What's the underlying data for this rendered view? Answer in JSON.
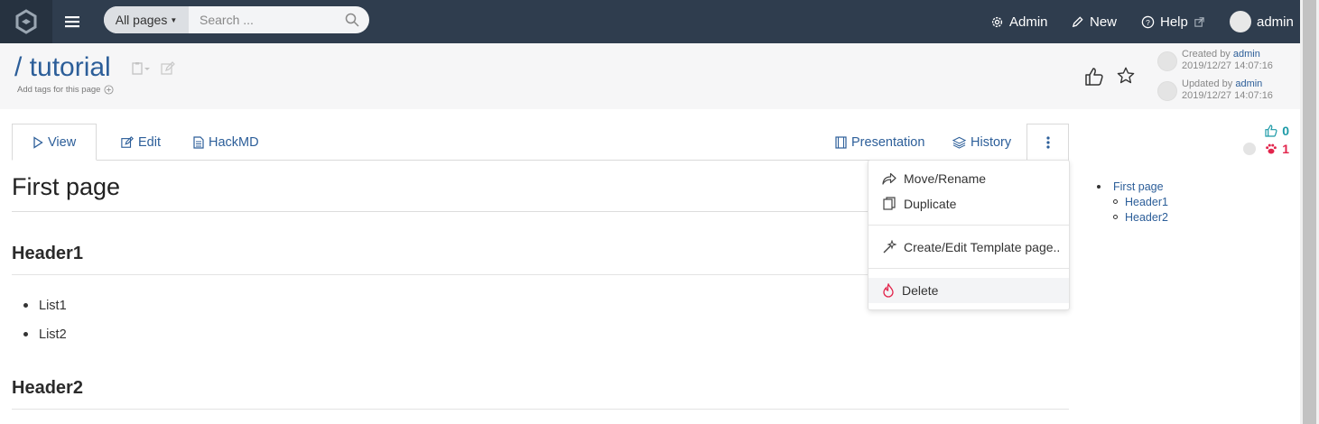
{
  "navbar": {
    "search_scope": "All pages",
    "search_placeholder": "Search ...",
    "admin_label": "Admin",
    "new_label": "New",
    "help_label": "Help",
    "user_label": "admin"
  },
  "page": {
    "path": "/ tutorial",
    "add_tags_text": "Add tags for this page",
    "created_prefix": "Created by",
    "created_user": "admin",
    "created_at": "2019/12/27 14:07:16",
    "updated_prefix": "Updated by",
    "updated_user": "admin",
    "updated_at": "2019/12/27 14:07:16"
  },
  "tabs": {
    "view": "View",
    "edit": "Edit",
    "hackmd": "HackMD",
    "presentation": "Presentation",
    "history": "History"
  },
  "dropdown": {
    "items": [
      "Move/Rename",
      "Duplicate",
      "Create/Edit Template page..",
      "Delete"
    ]
  },
  "content": {
    "title": "First page",
    "header1": "Header1",
    "list": [
      "List1",
      "List2"
    ],
    "header2": "Header2"
  },
  "counters": {
    "likes": "0",
    "seen": "1"
  },
  "toc": {
    "root": "First page",
    "children": [
      "Header1",
      "Header2"
    ]
  },
  "colors": {
    "navbar": "#2f3d4e",
    "link": "#2c5e99",
    "like_teal": "#1c9aa7",
    "seen_red": "#e2254c",
    "delete_icon": "#e2254c"
  }
}
